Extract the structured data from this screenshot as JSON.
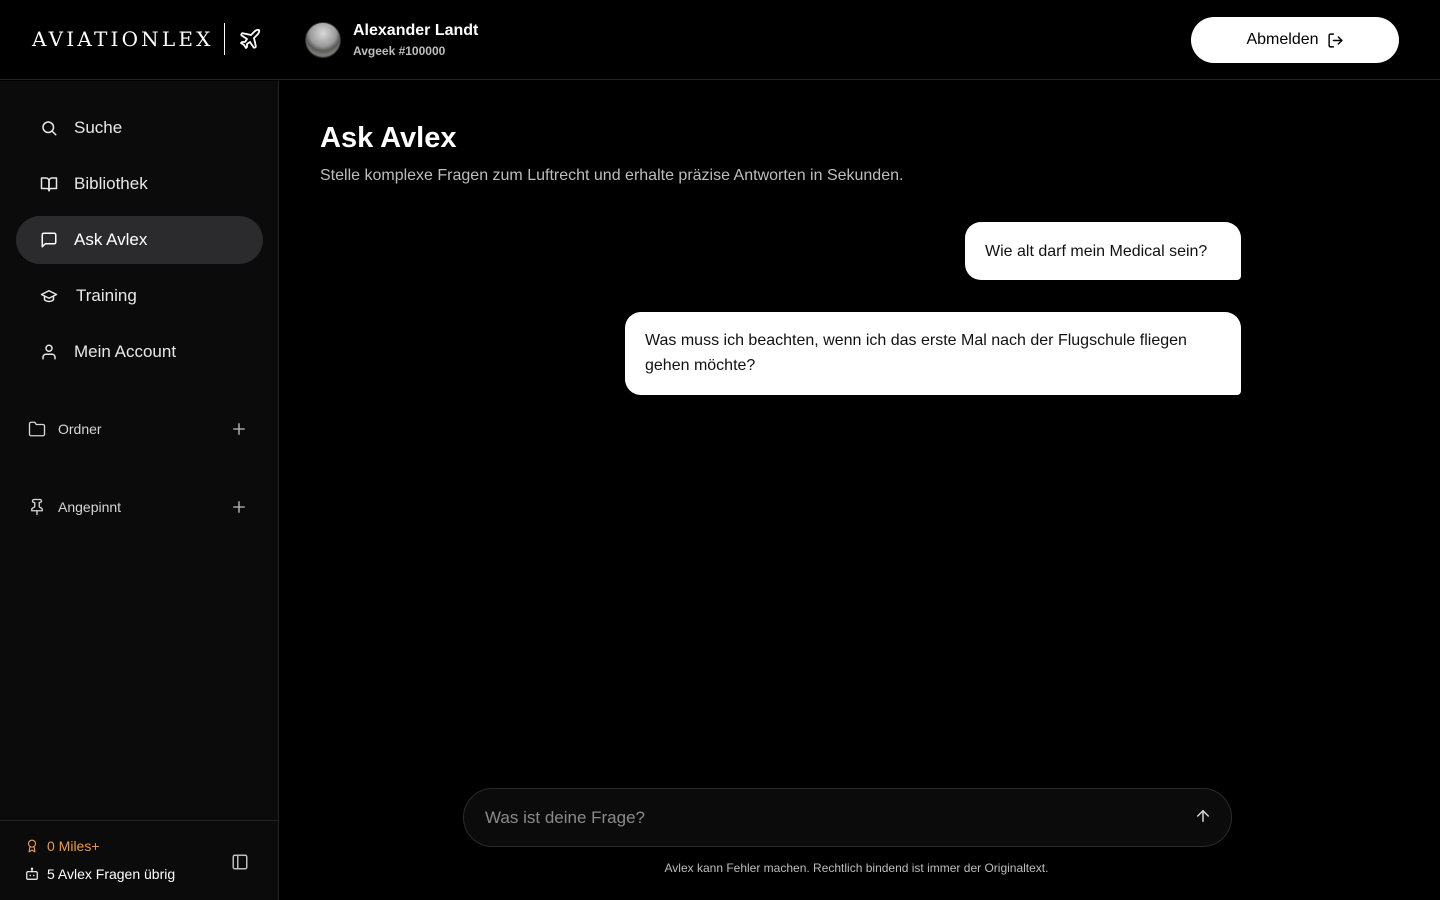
{
  "header": {
    "logo_text": "AVIATIONLEX",
    "user": {
      "name": "Alexander Landt",
      "subtitle": "Avgeek #100000"
    },
    "logout_label": "Abmelden"
  },
  "sidebar": {
    "items": [
      {
        "label": "Suche",
        "icon": "search-icon"
      },
      {
        "label": "Bibliothek",
        "icon": "book-icon"
      },
      {
        "label": "Ask Avlex",
        "icon": "chat-icon",
        "active": true
      },
      {
        "label": "Training",
        "icon": "graduation-cap-icon"
      },
      {
        "label": "Mein Account",
        "icon": "user-icon"
      }
    ],
    "sections": [
      {
        "label": "Ordner",
        "icon": "folder-icon"
      },
      {
        "label": "Angepinnt",
        "icon": "pin-icon"
      }
    ],
    "footer": {
      "miles": "0 Miles+",
      "quota": "5 Avlex Fragen übrig"
    }
  },
  "main": {
    "title": "Ask Avlex",
    "subtitle": "Stelle komplexe Fragen zum Luftrecht und erhalte präzise Antworten in Sekunden.",
    "messages": [
      {
        "role": "user",
        "text": "Wie alt darf mein Medical sein?"
      },
      {
        "role": "user",
        "text": "Was muss ich beachten, wenn ich das erste Mal nach der Flugschule fliegen gehen möchte?"
      }
    ],
    "composer": {
      "placeholder": "Was ist deine Frage?"
    },
    "disclaimer": "Avlex kann Fehler machen. Rechtlich bindend ist immer der Originaltext."
  },
  "colors": {
    "accent_orange": "#e89a4c",
    "active_nav": "#2b2b2d",
    "sidebar_bg": "#0b0b0c"
  }
}
